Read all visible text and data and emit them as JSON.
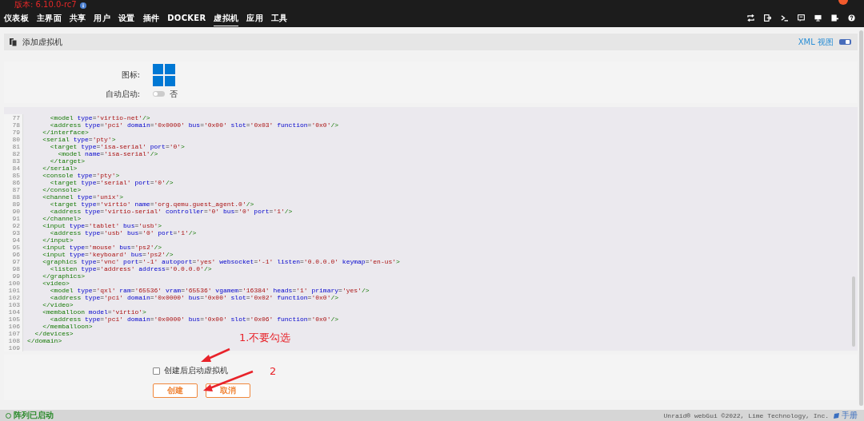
{
  "header": {
    "version": "版本: 6.10.0-rc7",
    "nav": [
      {
        "label": "仪表板",
        "selected": false
      },
      {
        "label": "主界面",
        "selected": false
      },
      {
        "label": "共享",
        "selected": false
      },
      {
        "label": "用户",
        "selected": false
      },
      {
        "label": "设置",
        "selected": false
      },
      {
        "label": "插件",
        "selected": false
      },
      {
        "label": "DOCKER",
        "selected": false
      },
      {
        "label": "虚拟机",
        "selected": true
      },
      {
        "label": "应用",
        "selected": false
      },
      {
        "label": "工具",
        "selected": false
      }
    ]
  },
  "page_header": {
    "title": "添加虚拟机",
    "xml_view": {
      "label": "XML 视图",
      "on": true
    }
  },
  "form": {
    "icon_label": "图标:",
    "autostart": {
      "label": "自动启动:",
      "on": false,
      "value": "否"
    }
  },
  "editor": {
    "lines": [
      {
        "number": "77",
        "code": "      <model type='virtio-net'/>"
      },
      {
        "number": "78",
        "code": "      <address type='pci' domain='0x0000' bus='0x00' slot='0x03' function='0x0'/>"
      },
      {
        "number": "79",
        "code": "    </interface>"
      },
      {
        "number": "80",
        "code": "    <serial type='pty'>"
      },
      {
        "number": "81",
        "code": "      <target type='isa-serial' port='0'>"
      },
      {
        "number": "82",
        "code": "        <model name='isa-serial'/>"
      },
      {
        "number": "83",
        "code": "      </target>"
      },
      {
        "number": "84",
        "code": "    </serial>"
      },
      {
        "number": "85",
        "code": "    <console type='pty'>"
      },
      {
        "number": "86",
        "code": "      <target type='serial' port='0'/>"
      },
      {
        "number": "87",
        "code": "    </console>"
      },
      {
        "number": "88",
        "code": "    <channel type='unix'>"
      },
      {
        "number": "89",
        "code": "      <target type='virtio' name='org.qemu.guest_agent.0'/>"
      },
      {
        "number": "90",
        "code": "      <address type='virtio-serial' controller='0' bus='0' port='1'/>"
      },
      {
        "number": "91",
        "code": "    </channel>"
      },
      {
        "number": "92",
        "code": "    <input type='tablet' bus='usb'>"
      },
      {
        "number": "93",
        "code": "      <address type='usb' bus='0' port='1'/>"
      },
      {
        "number": "94",
        "code": "    </input>"
      },
      {
        "number": "95",
        "code": "    <input type='mouse' bus='ps2'/>"
      },
      {
        "number": "96",
        "code": "    <input type='keyboard' bus='ps2'/>"
      },
      {
        "number": "97",
        "code": "    <graphics type='vnc' port='-1' autoport='yes' websocket='-1' listen='0.0.0.0' keymap='en-us'>"
      },
      {
        "number": "98",
        "code": "      <listen type='address' address='0.0.0.0'/>"
      },
      {
        "number": "99",
        "code": "    </graphics>"
      },
      {
        "number": "100",
        "code": "    <video>"
      },
      {
        "number": "101",
        "code": "      <model type='qxl' ram='65536' vram='65536' vgamem='16384' heads='1' primary='yes'/>"
      },
      {
        "number": "102",
        "code": "      <address type='pci' domain='0x0000' bus='0x00' slot='0x02' function='0x0'/>"
      },
      {
        "number": "103",
        "code": "    </video>"
      },
      {
        "number": "104",
        "code": "    <memballoon model='virtio'>"
      },
      {
        "number": "105",
        "code": "      <address type='pci' domain='0x0000' bus='0x00' slot='0x06' function='0x0'/>"
      },
      {
        "number": "106",
        "code": "    </memballoon>"
      },
      {
        "number": "107",
        "code": "  </devices>"
      },
      {
        "number": "108",
        "code": "</domain>"
      },
      {
        "number": "109"
      }
    ]
  },
  "options": {
    "start_after_create": {
      "label": "创建后启动虚拟机",
      "checked": false
    }
  },
  "buttons": [
    "创建",
    "取消"
  ],
  "annotations": [
    "1.不要勾选",
    "2"
  ],
  "footer": {
    "status": "阵列已启动",
    "copyright": "Unraid® webGui ©2022, Lime Technology, Inc.",
    "manual": "手册"
  }
}
